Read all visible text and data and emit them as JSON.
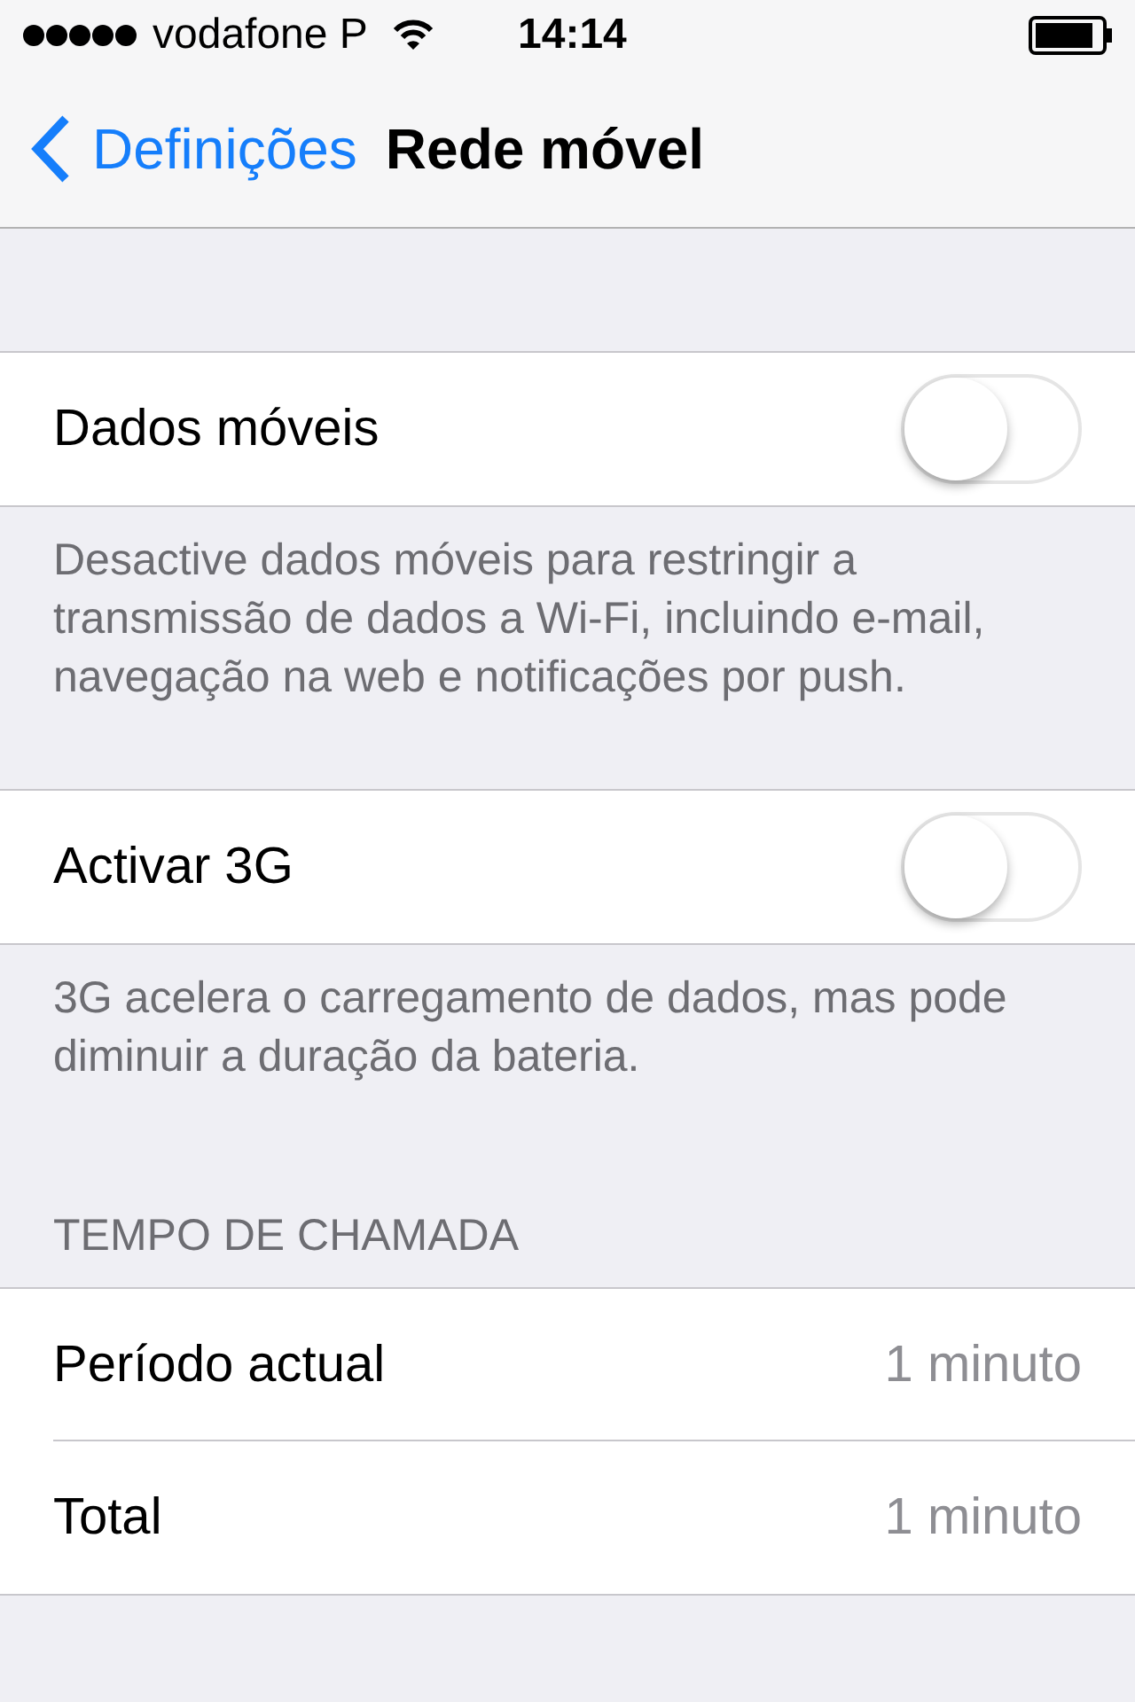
{
  "status_bar": {
    "carrier": "vodafone P",
    "time": "14:14"
  },
  "nav": {
    "back": "Definições",
    "title": "Rede móvel"
  },
  "sections": [
    {
      "rows": [
        {
          "kind": "toggle",
          "label": "Dados móveis",
          "on": false
        }
      ],
      "footer": "Desactive dados móveis para restringir a transmissão de dados a Wi-Fi, incluindo e-mail, navegação na web e notificações por push."
    },
    {
      "rows": [
        {
          "kind": "toggle",
          "label": "Activar 3G",
          "on": false
        }
      ],
      "footer": "3G acelera o carregamento de dados, mas pode diminuir a duração da bateria."
    },
    {
      "header": "TEMPO DE CHAMADA",
      "rows": [
        {
          "kind": "value",
          "label": "Período actual",
          "value": "1 minuto"
        },
        {
          "kind": "value",
          "label": "Total",
          "value": "1 minuto"
        }
      ]
    }
  ]
}
